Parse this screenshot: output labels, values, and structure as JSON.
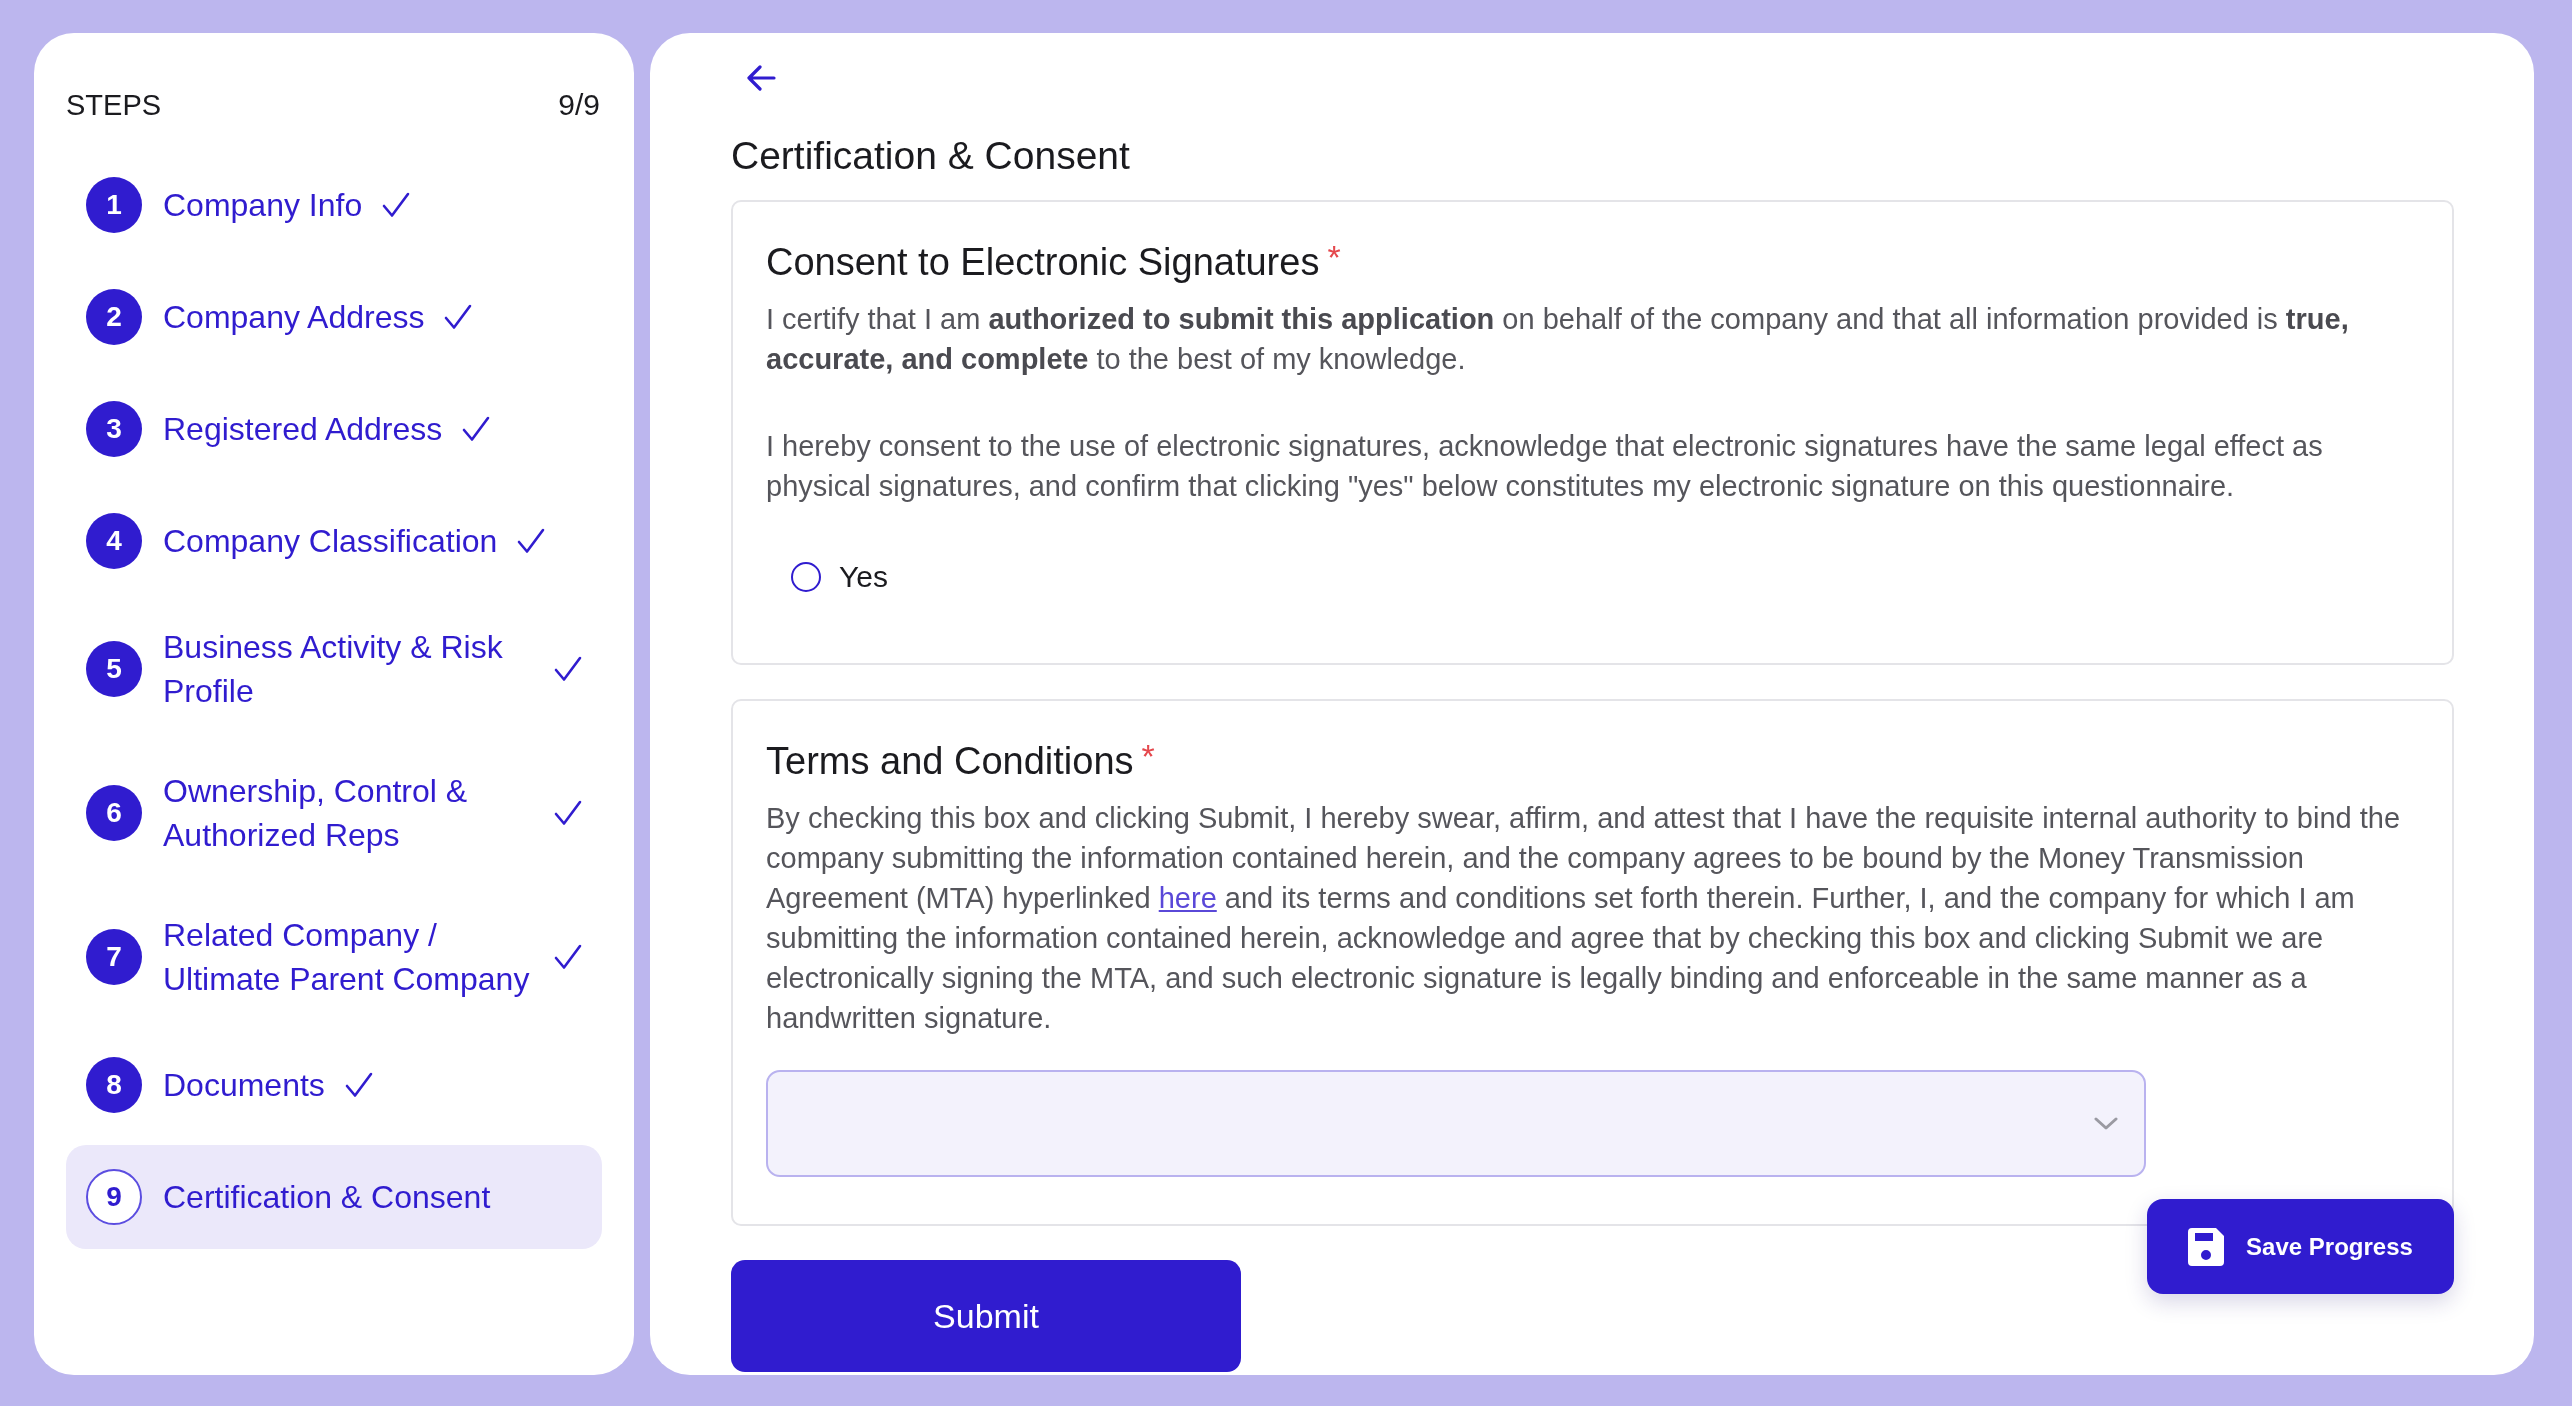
{
  "sidebar": {
    "title": "STEPS",
    "counter": "9/9",
    "steps": [
      {
        "number": "1",
        "label": "Company Info",
        "completed": true,
        "selected": false
      },
      {
        "number": "2",
        "label": "Company Address",
        "completed": true,
        "selected": false
      },
      {
        "number": "3",
        "label": "Registered Address",
        "completed": true,
        "selected": false
      },
      {
        "number": "4",
        "label": "Company Classification",
        "completed": true,
        "selected": false
      },
      {
        "number": "5",
        "label": "Business Activity & Risk Profile",
        "completed": true,
        "selected": false
      },
      {
        "number": "6",
        "label": "Ownership, Control & Authorized Reps",
        "completed": true,
        "selected": false
      },
      {
        "number": "7",
        "label": "Related Company / Ultimate Parent Company",
        "completed": true,
        "selected": false
      },
      {
        "number": "8",
        "label": "Documents",
        "completed": true,
        "selected": false
      },
      {
        "number": "9",
        "label": "Certification & Consent",
        "completed": false,
        "selected": true
      }
    ]
  },
  "form": {
    "title": "Certification & Consent",
    "sections": [
      {
        "title": "Consent to Electronic Signatures",
        "required_mark": "*",
        "paragraphs": [
          [
            {
              "kind": "text",
              "text": "I certify that I am **authorized to submit this application** on behalf of the company and that all information provided is **true, accurate, and complete** to the best of my knowledge."
            }
          ],
          [
            {
              "kind": "text",
              "text": "I hereby consent to the use of electronic signatures, acknowledge that electronic signatures have the same legal effect as physical signatures, and confirm that clicking \"yes\" below constitutes my electronic signature on this questionnaire."
            }
          ]
        ],
        "control": {
          "kind": "radio",
          "options": [
            {
              "label": "Yes",
              "selected": false
            }
          ]
        }
      },
      {
        "title": "Terms and Conditions",
        "required_mark": "*",
        "paragraphs": [
          [
            {
              "kind": "text",
              "text": "By checking this box and clicking Submit, I hereby swear, affirm, and attest that I have the requisite internal authority to bind the company submitting the information contained herein, and the company agrees to be bound by the Money Transmission Agreement (MTA) hyperlinked "
            },
            {
              "kind": "link",
              "text": "here"
            },
            {
              "kind": "text",
              "text": " and its terms and conditions set forth therein. Further, I, and the company for which I am submitting the information contained herein, acknowledge and agree that by checking this box and clicking Submit we are electronically signing the MTA, and such electronic signature is legally binding and enforceable in the same manner as a handwritten signature."
            }
          ]
        ],
        "control": {
          "kind": "select"
        }
      }
    ],
    "submit_button": {
      "label": "Submit"
    },
    "save_button": {
      "label": "Save Progress"
    }
  }
}
